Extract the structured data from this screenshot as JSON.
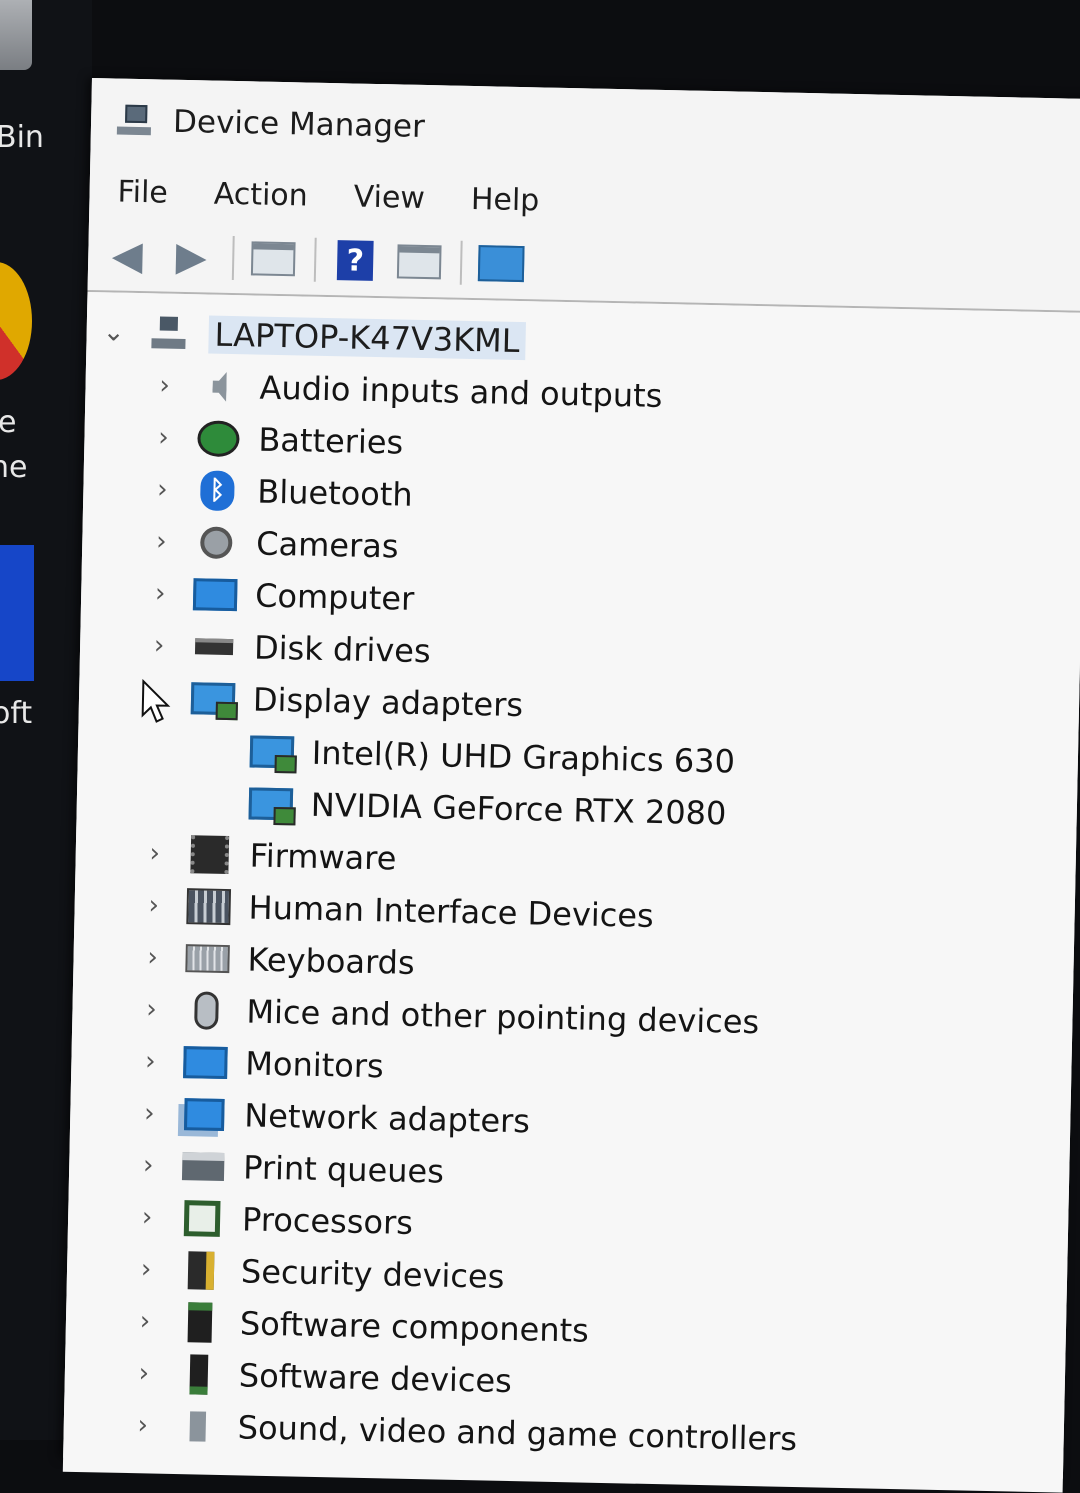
{
  "desktop": {
    "labels": [
      "Bin",
      "e",
      "ne",
      "oft"
    ]
  },
  "window": {
    "title": "Device Manager"
  },
  "menu": [
    "File",
    "Action",
    "View",
    "Help"
  ],
  "toolbar": {
    "back_icon": "back-arrow-icon",
    "forward_icon": "forward-arrow-icon",
    "help_glyph": "?"
  },
  "tree": {
    "root": "LAPTOP-K47V3KML",
    "expanded_glyph": "⌄",
    "collapsed_glyph": "›",
    "categories": [
      {
        "label": "Audio inputs and outputs",
        "icon": "speaker-icon"
      },
      {
        "label": "Batteries",
        "icon": "battery-icon"
      },
      {
        "label": "Bluetooth",
        "icon": "bluetooth-icon"
      },
      {
        "label": "Cameras",
        "icon": "camera-icon"
      },
      {
        "label": "Computer",
        "icon": "monitor-icon"
      },
      {
        "label": "Disk drives",
        "icon": "disk-icon"
      },
      {
        "label": "Display adapters",
        "icon": "display-adapter-icon"
      },
      {
        "label": "Firmware",
        "icon": "chip-icon"
      },
      {
        "label": "Human Interface Devices",
        "icon": "hid-icon"
      },
      {
        "label": "Keyboards",
        "icon": "keyboard-icon"
      },
      {
        "label": "Mice and other pointing devices",
        "icon": "mouse-icon"
      },
      {
        "label": "Monitors",
        "icon": "monitor-icon"
      },
      {
        "label": "Network adapters",
        "icon": "network-icon"
      },
      {
        "label": "Print queues",
        "icon": "printer-icon"
      },
      {
        "label": "Processors",
        "icon": "processor-icon"
      },
      {
        "label": "Security devices",
        "icon": "security-icon"
      },
      {
        "label": "Software components",
        "icon": "software-component-icon"
      },
      {
        "label": "Software devices",
        "icon": "software-device-icon"
      },
      {
        "label": "Sound, video and game controllers",
        "icon": "sound-icon"
      }
    ],
    "display_adapters": [
      {
        "label": "Intel(R) UHD Graphics 630"
      },
      {
        "label": "NVIDIA GeForce RTX 2080"
      }
    ]
  }
}
